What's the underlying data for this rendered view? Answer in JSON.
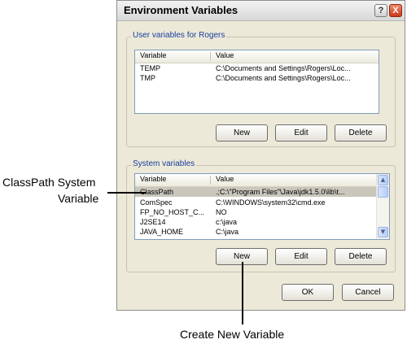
{
  "dialog": {
    "title": "Environment Variables",
    "help_glyph": "?",
    "close_glyph": "X"
  },
  "user_vars": {
    "group_label": "User variables for Rogers",
    "columns": [
      "Variable",
      "Value"
    ],
    "rows": [
      {
        "name": "TEMP",
        "value": "C:\\Documents and Settings\\Rogers\\Loc..."
      },
      {
        "name": "TMP",
        "value": "C:\\Documents and Settings\\Rogers\\Loc..."
      }
    ],
    "buttons": {
      "new": "New",
      "edit": "Edit",
      "delete": "Delete"
    }
  },
  "system_vars": {
    "group_label": "System variables",
    "columns": [
      "Variable",
      "Value"
    ],
    "rows": [
      {
        "name": "ClassPath",
        "value": ".;C:\\\"Program Files\"\\Java\\jdk1.5.0\\lib\\t...",
        "selected": true
      },
      {
        "name": "ComSpec",
        "value": "C:\\WINDOWS\\system32\\cmd.exe"
      },
      {
        "name": "FP_NO_HOST_C...",
        "value": "NO"
      },
      {
        "name": "J2SE14",
        "value": "c:\\java"
      },
      {
        "name": "JAVA_HOME",
        "value": "C:\\java"
      }
    ],
    "buttons": {
      "new": "New",
      "edit": "Edit",
      "delete": "Delete"
    }
  },
  "footer": {
    "ok": "OK",
    "cancel": "Cancel"
  },
  "callouts": {
    "classpath_line1": "ClassPath System",
    "classpath_line2": "Variable",
    "new_variable": "Create New Variable"
  }
}
